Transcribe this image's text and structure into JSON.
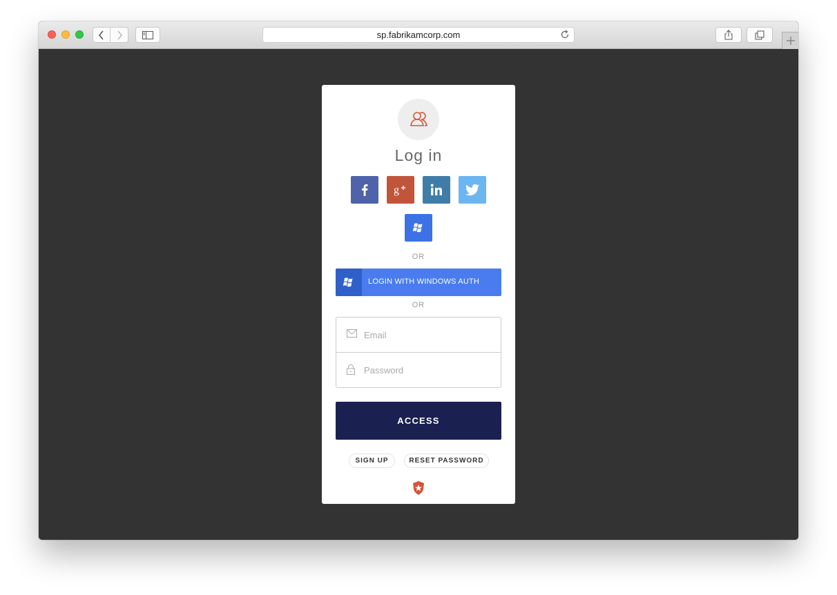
{
  "browser": {
    "url": "sp.fabrikamcorp.com"
  },
  "login": {
    "title": "Log in",
    "social": [
      {
        "name": "facebook",
        "icon": "facebook-icon",
        "color": "#4e63a9"
      },
      {
        "name": "google-plus",
        "icon": "google-plus-icon",
        "color": "#c1553a"
      },
      {
        "name": "linkedin",
        "icon": "linkedin-icon",
        "color": "#3f7da8"
      },
      {
        "name": "twitter",
        "icon": "twitter-icon",
        "color": "#6bb5f0"
      },
      {
        "name": "windows",
        "icon": "windows-icon",
        "color": "#3d72e7"
      }
    ],
    "or_1": "OR",
    "windows_auth_label": "LOGIN WITH WINDOWS AUTH",
    "or_2": "OR",
    "email_placeholder": "Email",
    "password_placeholder": "Password",
    "access_label": "ACCESS",
    "signup_label": "SIGN UP",
    "reset_label": "RESET PASSWORD"
  },
  "colors": {
    "background": "#333333",
    "accent": "#1a2150",
    "brand_orange": "#d2553a"
  }
}
